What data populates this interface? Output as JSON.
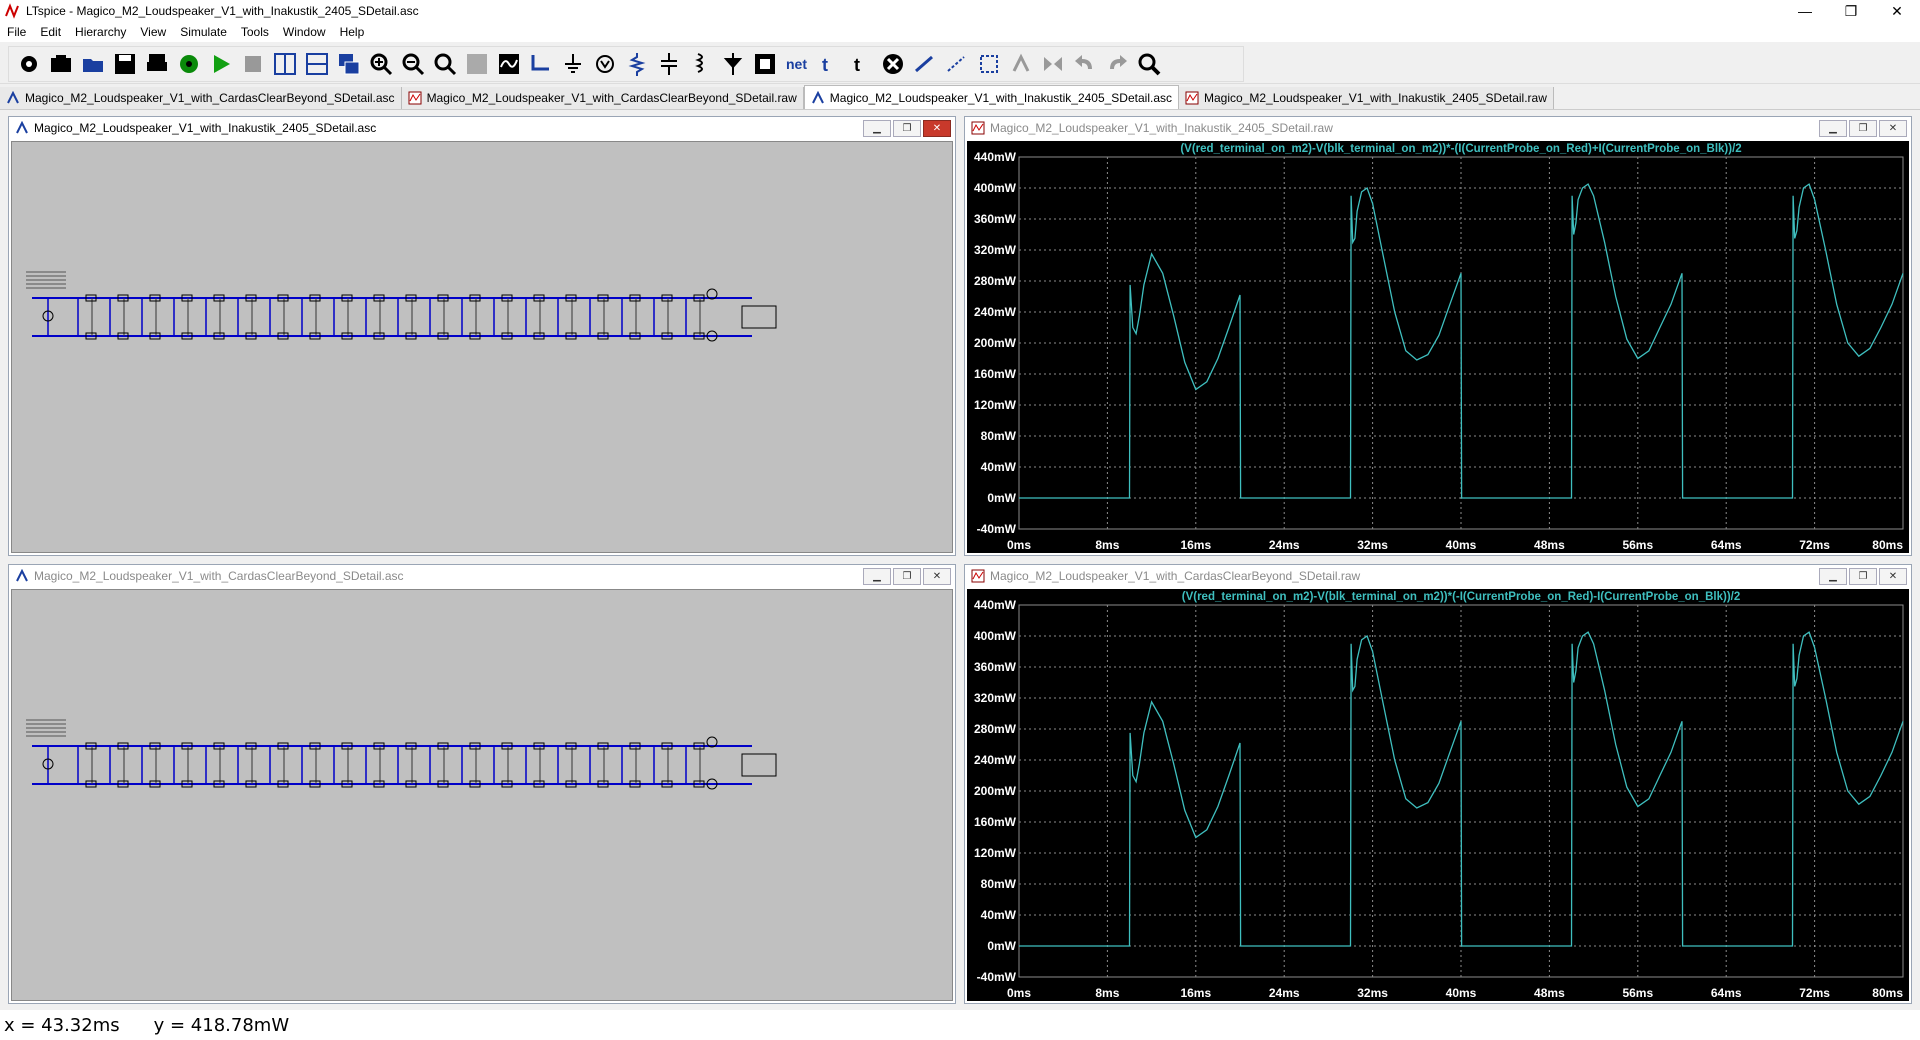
{
  "app": {
    "title": "LTspice - Magico_M2_Loudspeaker_V1_with_Inakustik_2405_SDetail.asc",
    "minimize": "—",
    "maximize": "❐",
    "close": "✕"
  },
  "menu": [
    "File",
    "Edit",
    "Hierarchy",
    "View",
    "Simulate",
    "Tools",
    "Window",
    "Help"
  ],
  "toolbar_icons": [
    "gear-icon",
    "open-icon",
    "open-folder-icon",
    "save-icon",
    "print-icon",
    "control-panel-icon",
    "run-icon",
    "halt-icon",
    "tile-vertical-icon",
    "tile-horizontal-icon",
    "cascade-icon",
    "zoom-in-icon",
    "zoom-out-icon",
    "zoom-fit-icon",
    "zoom-back-icon",
    "autorange-icon",
    "wire-icon",
    "ground-icon",
    "component-icon",
    "resistor-icon",
    "capacitor-icon",
    "inductor-icon",
    "diode-icon",
    "component-library-icon",
    "net-label-icon",
    "text-icon",
    "spice-directive-icon",
    "delete-icon",
    "duplicate-icon",
    "move-icon",
    "drag-icon",
    "rotate-icon",
    "mirror-icon",
    "undo-icon",
    "redo-icon",
    "find-icon"
  ],
  "tabs": [
    {
      "label": "Magico_M2_Loudspeaker_V1_with_CardasClearBeyond_SDetail.asc",
      "type": "schematic",
      "active": false
    },
    {
      "label": "Magico_M2_Loudspeaker_V1_with_CardasClearBeyond_SDetail.raw",
      "type": "waveform",
      "active": false
    },
    {
      "label": "Magico_M2_Loudspeaker_V1_with_Inakustik_2405_SDetail.asc",
      "type": "schematic",
      "active": true
    },
    {
      "label": "Magico_M2_Loudspeaker_V1_with_Inakustik_2405_SDetail.raw",
      "type": "waveform",
      "active": false
    }
  ],
  "windows": {
    "schem_top": {
      "title": "Magico_M2_Loudspeaker_V1_with_Inakustik_2405_SDetail.asc"
    },
    "schem_bottom": {
      "title": "Magico_M2_Loudspeaker_V1_with_CardasClearBeyond_SDetail.asc"
    },
    "plot_top": {
      "title": "Magico_M2_Loudspeaker_V1_with_Inakustik_2405_SDetail.raw"
    },
    "plot_bottom": {
      "title": "Magico_M2_Loudspeaker_V1_with_CardasClearBeyond_SDetail.raw"
    }
  },
  "colors": {
    "trace": "#3fbfbf",
    "grid": "#8c8c8c",
    "axis_text": "#ffffff",
    "plot_bg": "#000000",
    "schematic_bg": "#c0c0c0",
    "wire": "#0000c8"
  },
  "chart_data": [
    {
      "type": "line",
      "title": "(V(red_terminal_on_m2)-V(blk_terminal_on_m2))*-(I(CurrentProbe_on_Red)+I(CurrentProbe_on_Blk))/2",
      "xlim": [
        0,
        80
      ],
      "ylim": [
        -40,
        440
      ],
      "x_ticks": [
        "0ms",
        "8ms",
        "16ms",
        "24ms",
        "32ms",
        "40ms",
        "48ms",
        "56ms",
        "64ms",
        "72ms",
        "80ms"
      ],
      "y_ticks": [
        "440mW",
        "400mW",
        "360mW",
        "320mW",
        "280mW",
        "240mW",
        "200mW",
        "160mW",
        "120mW",
        "80mW",
        "40mW",
        "0mW",
        "-40mW"
      ],
      "grid": true,
      "series": [
        {
          "x": [
            0,
            10,
            10.05,
            10.3,
            10.6,
            10.9,
            11.3,
            12,
            13,
            14,
            15,
            16,
            17,
            18,
            19,
            20,
            20.05,
            30,
            30.05,
            30.2,
            30.4,
            30.6,
            31,
            31.5,
            32,
            33,
            34,
            35,
            36,
            37,
            38,
            39,
            40,
            40.05,
            50,
            50.05,
            50.2,
            50.4,
            50.6,
            51,
            51.5,
            52,
            53,
            54,
            55,
            56,
            57,
            58,
            59,
            60,
            60.05,
            70,
            70.05,
            70.2,
            70.4,
            70.6,
            71,
            71.5,
            72,
            73,
            74,
            75,
            76,
            77,
            78,
            79,
            80
          ],
          "y": [
            0,
            0,
            275,
            220,
            212,
            235,
            275,
            315,
            290,
            235,
            175,
            140,
            150,
            180,
            220,
            262,
            0,
            0,
            390,
            330,
            335,
            370,
            395,
            400,
            380,
            310,
            240,
            190,
            178,
            185,
            210,
            250,
            290,
            0,
            0,
            390,
            340,
            355,
            385,
            400,
            405,
            390,
            330,
            260,
            205,
            180,
            190,
            220,
            250,
            290,
            0,
            0,
            390,
            335,
            345,
            375,
            400,
            405,
            385,
            320,
            250,
            200,
            183,
            193,
            220,
            250,
            290
          ]
        }
      ]
    },
    {
      "type": "line",
      "title": "(V(red_terminal_on_m2)-V(blk_terminal_on_m2))*(-I(CurrentProbe_on_Red)-I(CurrentProbe_on_Blk))/2",
      "xlim": [
        0,
        80
      ],
      "ylim": [
        -40,
        440
      ],
      "x_ticks": [
        "0ms",
        "8ms",
        "16ms",
        "24ms",
        "32ms",
        "40ms",
        "48ms",
        "56ms",
        "64ms",
        "72ms",
        "80ms"
      ],
      "y_ticks": [
        "440mW",
        "400mW",
        "360mW",
        "320mW",
        "280mW",
        "240mW",
        "200mW",
        "160mW",
        "120mW",
        "80mW",
        "40mW",
        "0mW",
        "-40mW"
      ],
      "grid": true,
      "series": [
        {
          "x": [
            0,
            10,
            10.05,
            10.3,
            10.6,
            10.9,
            11.3,
            12,
            13,
            14,
            15,
            16,
            17,
            18,
            19,
            20,
            20.05,
            30,
            30.05,
            30.2,
            30.4,
            30.6,
            31,
            31.5,
            32,
            33,
            34,
            35,
            36,
            37,
            38,
            39,
            40,
            40.05,
            50,
            50.05,
            50.2,
            50.4,
            50.6,
            51,
            51.5,
            52,
            53,
            54,
            55,
            56,
            57,
            58,
            59,
            60,
            60.05,
            70,
            70.05,
            70.2,
            70.4,
            70.6,
            71,
            71.5,
            72,
            73,
            74,
            75,
            76,
            77,
            78,
            79,
            80
          ],
          "y": [
            0,
            0,
            275,
            220,
            212,
            235,
            275,
            315,
            290,
            235,
            175,
            140,
            150,
            180,
            220,
            262,
            0,
            0,
            390,
            330,
            335,
            370,
            395,
            400,
            380,
            310,
            240,
            190,
            178,
            185,
            210,
            250,
            290,
            0,
            0,
            390,
            340,
            355,
            385,
            400,
            405,
            390,
            330,
            260,
            205,
            180,
            190,
            220,
            250,
            290,
            0,
            0,
            390,
            335,
            345,
            375,
            400,
            405,
            385,
            320,
            250,
            200,
            183,
            193,
            220,
            250,
            290
          ]
        }
      ]
    }
  ],
  "status": {
    "x": "x = 43.32ms",
    "y": "y = 418.78mW"
  }
}
